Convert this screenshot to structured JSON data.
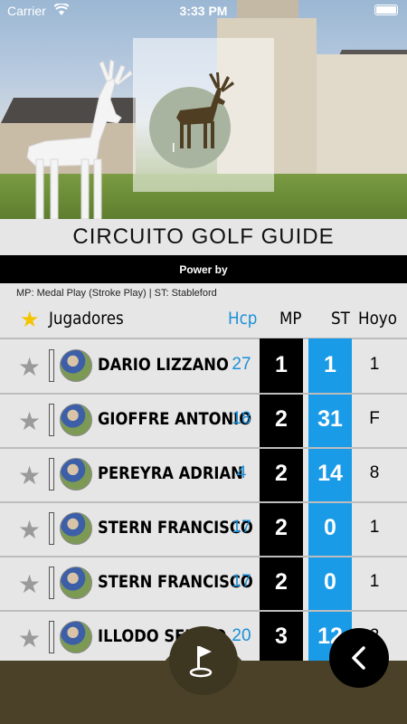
{
  "status_bar": {
    "carrier": "Carrier",
    "time": "3:33 PM"
  },
  "title": "CIRCUITO GOLF GUIDE",
  "power_by": "Power by",
  "legend": "MP: Medal Play (Stroke Play) | ST: Stableford",
  "columns": {
    "players": "Jugadores",
    "hcp": "Hcp",
    "mp": "MP",
    "st": "ST",
    "hoyo": "Hoyo"
  },
  "colors": {
    "hcp": "#1a8fd9",
    "st_column": "#1a9be8",
    "mp_column": "#000000",
    "star_header": "#f5c400",
    "bottom_bar": "#4a4128"
  },
  "players": [
    {
      "name": "DARIO LIZZANO",
      "hcp": "27",
      "mp": "1",
      "st": "1",
      "hoyo": "1"
    },
    {
      "name": "GIOFFRE ANTONIO",
      "hcp": "18",
      "mp": "2",
      "st": "31",
      "hoyo": "F"
    },
    {
      "name": "PEREYRA ADRIAN",
      "hcp": "4",
      "mp": "2",
      "st": "14",
      "hoyo": "8"
    },
    {
      "name": "STERN FRANCISCO",
      "hcp": "17",
      "mp": "2",
      "st": "0",
      "hoyo": "1"
    },
    {
      "name": "STERN FRANCISCO",
      "hcp": "17",
      "mp": "2",
      "st": "0",
      "hoyo": "1"
    },
    {
      "name": "ILLODO SERGIO",
      "hcp": "20",
      "mp": "3",
      "st": "12",
      "hoyo": "2"
    }
  ],
  "icons": {
    "favorite": "star-icon",
    "flag": "golf-flag-icon",
    "back": "chevron-left-icon"
  }
}
